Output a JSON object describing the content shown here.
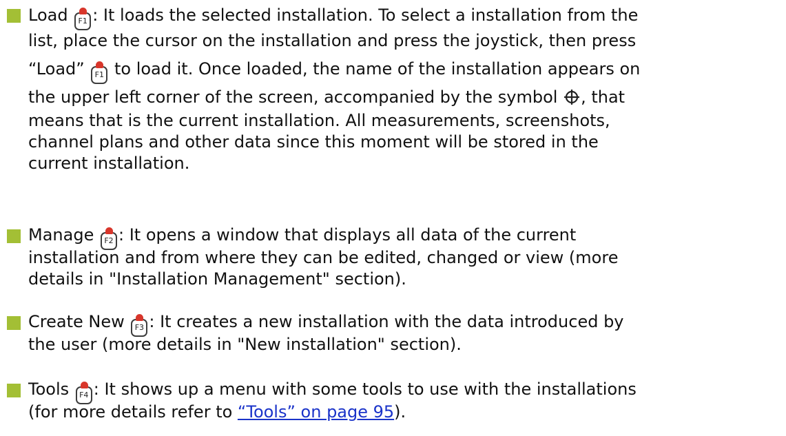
{
  "items": [
    {
      "label": "Load",
      "key": "F1",
      "line1_text": ": It loads the selected installation. To select a installation from the",
      "line2": "list, place the cursor on the installation and press the joystick, then press",
      "line3_pre": "“Load”",
      "line3_key": "F1",
      "line3_post": "to load it. Once loaded, the name of the installation appears on",
      "line4_pre": "the upper left corner of the screen, accompanied by the symbol",
      "line4_icon": "target-icon",
      "line4_post": ", that",
      "line5": "means that is the current installation. All measurements, screenshots,",
      "line6": "channel plans and other data since this moment will be stored in the",
      "line7": "current installation."
    },
    {
      "label": "Manage",
      "key": "F2",
      "line1_text": ": It opens a window that displays all data of the current",
      "line2": "installation and from where they can be edited, changed or view (more",
      "line3": "details in \"Installation Management\" section)."
    },
    {
      "label": "Create New",
      "key": "F3",
      "line1_text": ": It creates a new installation with the data introduced by",
      "line2": "the user (more details in \"New installation\" section)."
    },
    {
      "label": "Tools",
      "key": "F4",
      "line1_text": ": It shows up a menu with some tools to use with the installations",
      "line2_pre": "(for more details refer to ",
      "line2_link": "“Tools” on page 95",
      "line2_post": ")."
    }
  ],
  "colors": {
    "bullet": "#a3bf35",
    "link": "#1a33c9",
    "key_cap": "#d8362b"
  }
}
